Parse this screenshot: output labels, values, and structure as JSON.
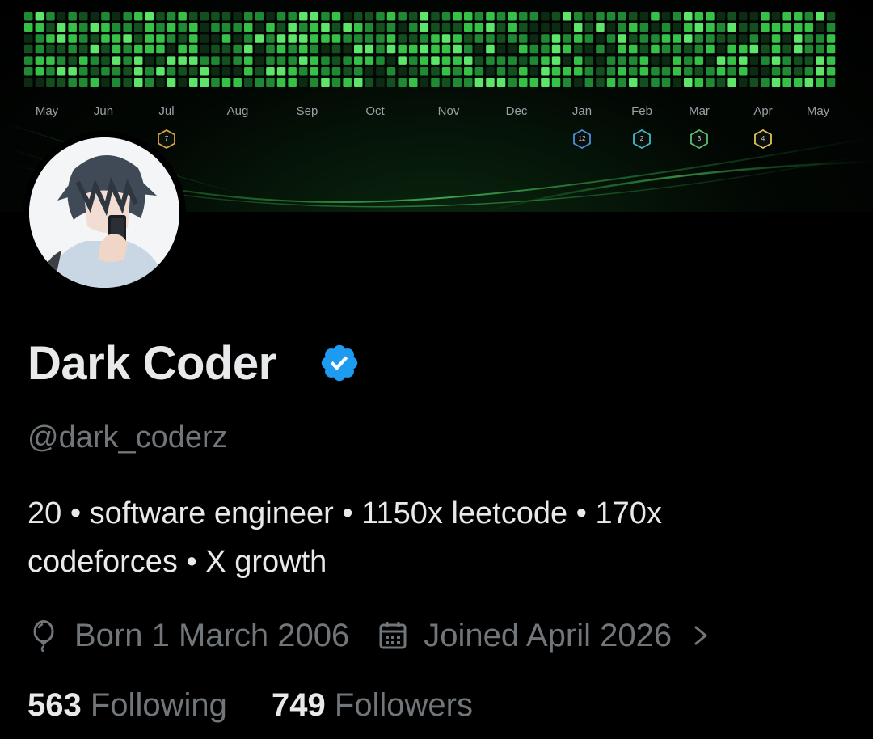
{
  "banner": {
    "months": [
      "May",
      "Jun",
      "Jul",
      "Aug",
      "Sep",
      "Oct",
      "Nov",
      "Dec",
      "Jan",
      "Feb",
      "Mar",
      "Apr",
      "May"
    ],
    "badges": [
      {
        "month": "Jul",
        "number": "7",
        "color": "#d9a441"
      },
      {
        "month": "Jan",
        "number": "12",
        "color": "#4a90d9"
      },
      {
        "month": "Feb",
        "number": "2",
        "color": "#3fb8c8"
      },
      {
        "month": "Mar",
        "number": "3",
        "color": "#5cc06a"
      },
      {
        "month": "Apr",
        "number": "4",
        "color": "#e0c25a"
      }
    ],
    "cell_colors": [
      "#0d2a12",
      "#14501f",
      "#1f8a33",
      "#36c247",
      "#5ee66a"
    ]
  },
  "profile": {
    "name": "Dark Coder",
    "handle": "@dark_coderz",
    "verified_color": "#1d9bf0",
    "bio_line1": "20 • software engineer • 1150x leetcode • 170x",
    "bio_line2": "codeforces • X growth",
    "born": "Born 1 March 2006",
    "joined": "Joined April 2026",
    "following_count": "563",
    "following_label": "Following",
    "followers_count": "749",
    "followers_label": "Followers"
  },
  "icons": {
    "born": "balloon-icon",
    "joined": "calendar-icon",
    "chevron": "chevron-right-icon",
    "verified": "verified-badge-icon"
  }
}
